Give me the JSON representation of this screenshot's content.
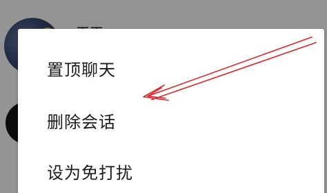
{
  "chat_list": {
    "items": [
      {
        "name": "王王"
      },
      {
        "name": ""
      }
    ]
  },
  "context_menu": {
    "items": [
      {
        "label": "置顶聊天"
      },
      {
        "label": "删除会话"
      },
      {
        "label": "设为免打扰"
      }
    ]
  },
  "annotation": {
    "arrow_color": "#d9252a",
    "points_to": "删除会话"
  }
}
